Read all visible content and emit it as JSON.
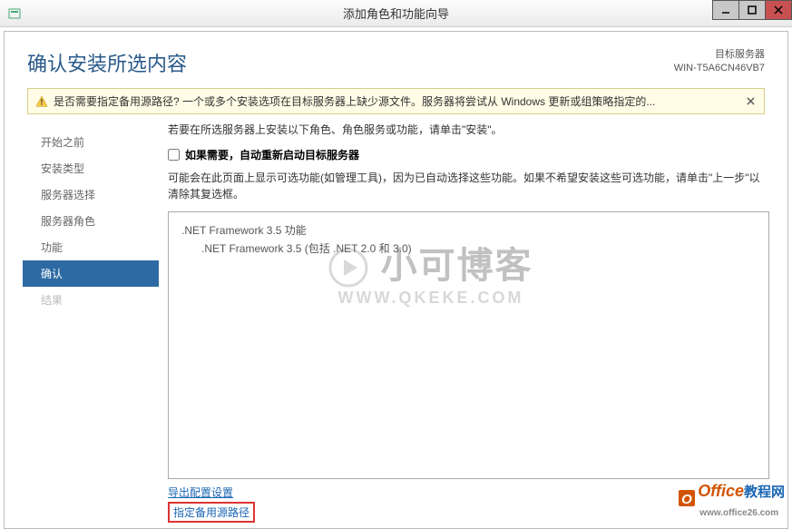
{
  "window": {
    "title": "添加角色和功能向导"
  },
  "header": {
    "page_title": "确认安装所选内容",
    "server_label": "目标服务器",
    "server_name": "WIN-T5A6CN46VB7"
  },
  "warning": {
    "text": "是否需要指定备用源路径? 一个或多个安装选项在目标服务器上缺少源文件。服务器将尝试从 Windows 更新或组策略指定的..."
  },
  "sidebar": {
    "items": [
      {
        "label": "开始之前",
        "state": "normal"
      },
      {
        "label": "安装类型",
        "state": "normal"
      },
      {
        "label": "服务器选择",
        "state": "normal"
      },
      {
        "label": "服务器角色",
        "state": "normal"
      },
      {
        "label": "功能",
        "state": "normal"
      },
      {
        "label": "确认",
        "state": "active"
      },
      {
        "label": "结果",
        "state": "disabled"
      }
    ]
  },
  "main": {
    "instruction": "若要在所选服务器上安装以下角色、角色服务或功能，请单击\"安装\"。",
    "checkbox_label": "如果需要，自动重新启动目标服务器",
    "note": "可能会在此页面上显示可选功能(如管理工具)，因为已自动选择这些功能。如果不希望安装这些可选功能，请单击\"上一步\"以清除其复选框。",
    "features": [
      ".NET Framework 3.5 功能",
      ".NET Framework 3.5 (包括 .NET 2.0 和 3.0)"
    ],
    "links": {
      "export": "导出配置设置",
      "alt_path": "指定备用源路径"
    }
  },
  "watermark": {
    "title": "小可博客",
    "url": "WWW.QKEKE.COM"
  },
  "footer": {
    "brand1": "Office",
    "brand2": "教程网",
    "url": "www.office26.com"
  }
}
